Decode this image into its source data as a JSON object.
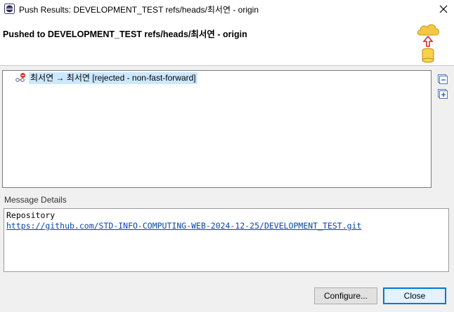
{
  "window": {
    "title": "Push Results: DEVELOPMENT_TEST refs/heads/최서연 - origin"
  },
  "banner": {
    "heading": "Pushed to DEVELOPMENT_TEST refs/heads/최서연 - origin",
    "icon": "push-to-remote-icon"
  },
  "results": {
    "rows": [
      {
        "text": "최서연 → 최서연 [rejected - non-fast-forward]",
        "icon": "rejected-ref-icon"
      }
    ]
  },
  "side_buttons": {
    "collapse_icon": "collapse-all-icon",
    "expand_icon": "expand-all-icon"
  },
  "message": {
    "label": "Message Details",
    "line1": "Repository",
    "url": "https://github.com/STD-INFO-COMPUTING-WEB-2024-12-25/DEVELOPMENT_TEST.git"
  },
  "buttons": {
    "configure": "Configure...",
    "close": "Close"
  },
  "colors": {
    "selection": "#cce8ff",
    "link": "#0645ad",
    "accent": "#0078d7"
  }
}
